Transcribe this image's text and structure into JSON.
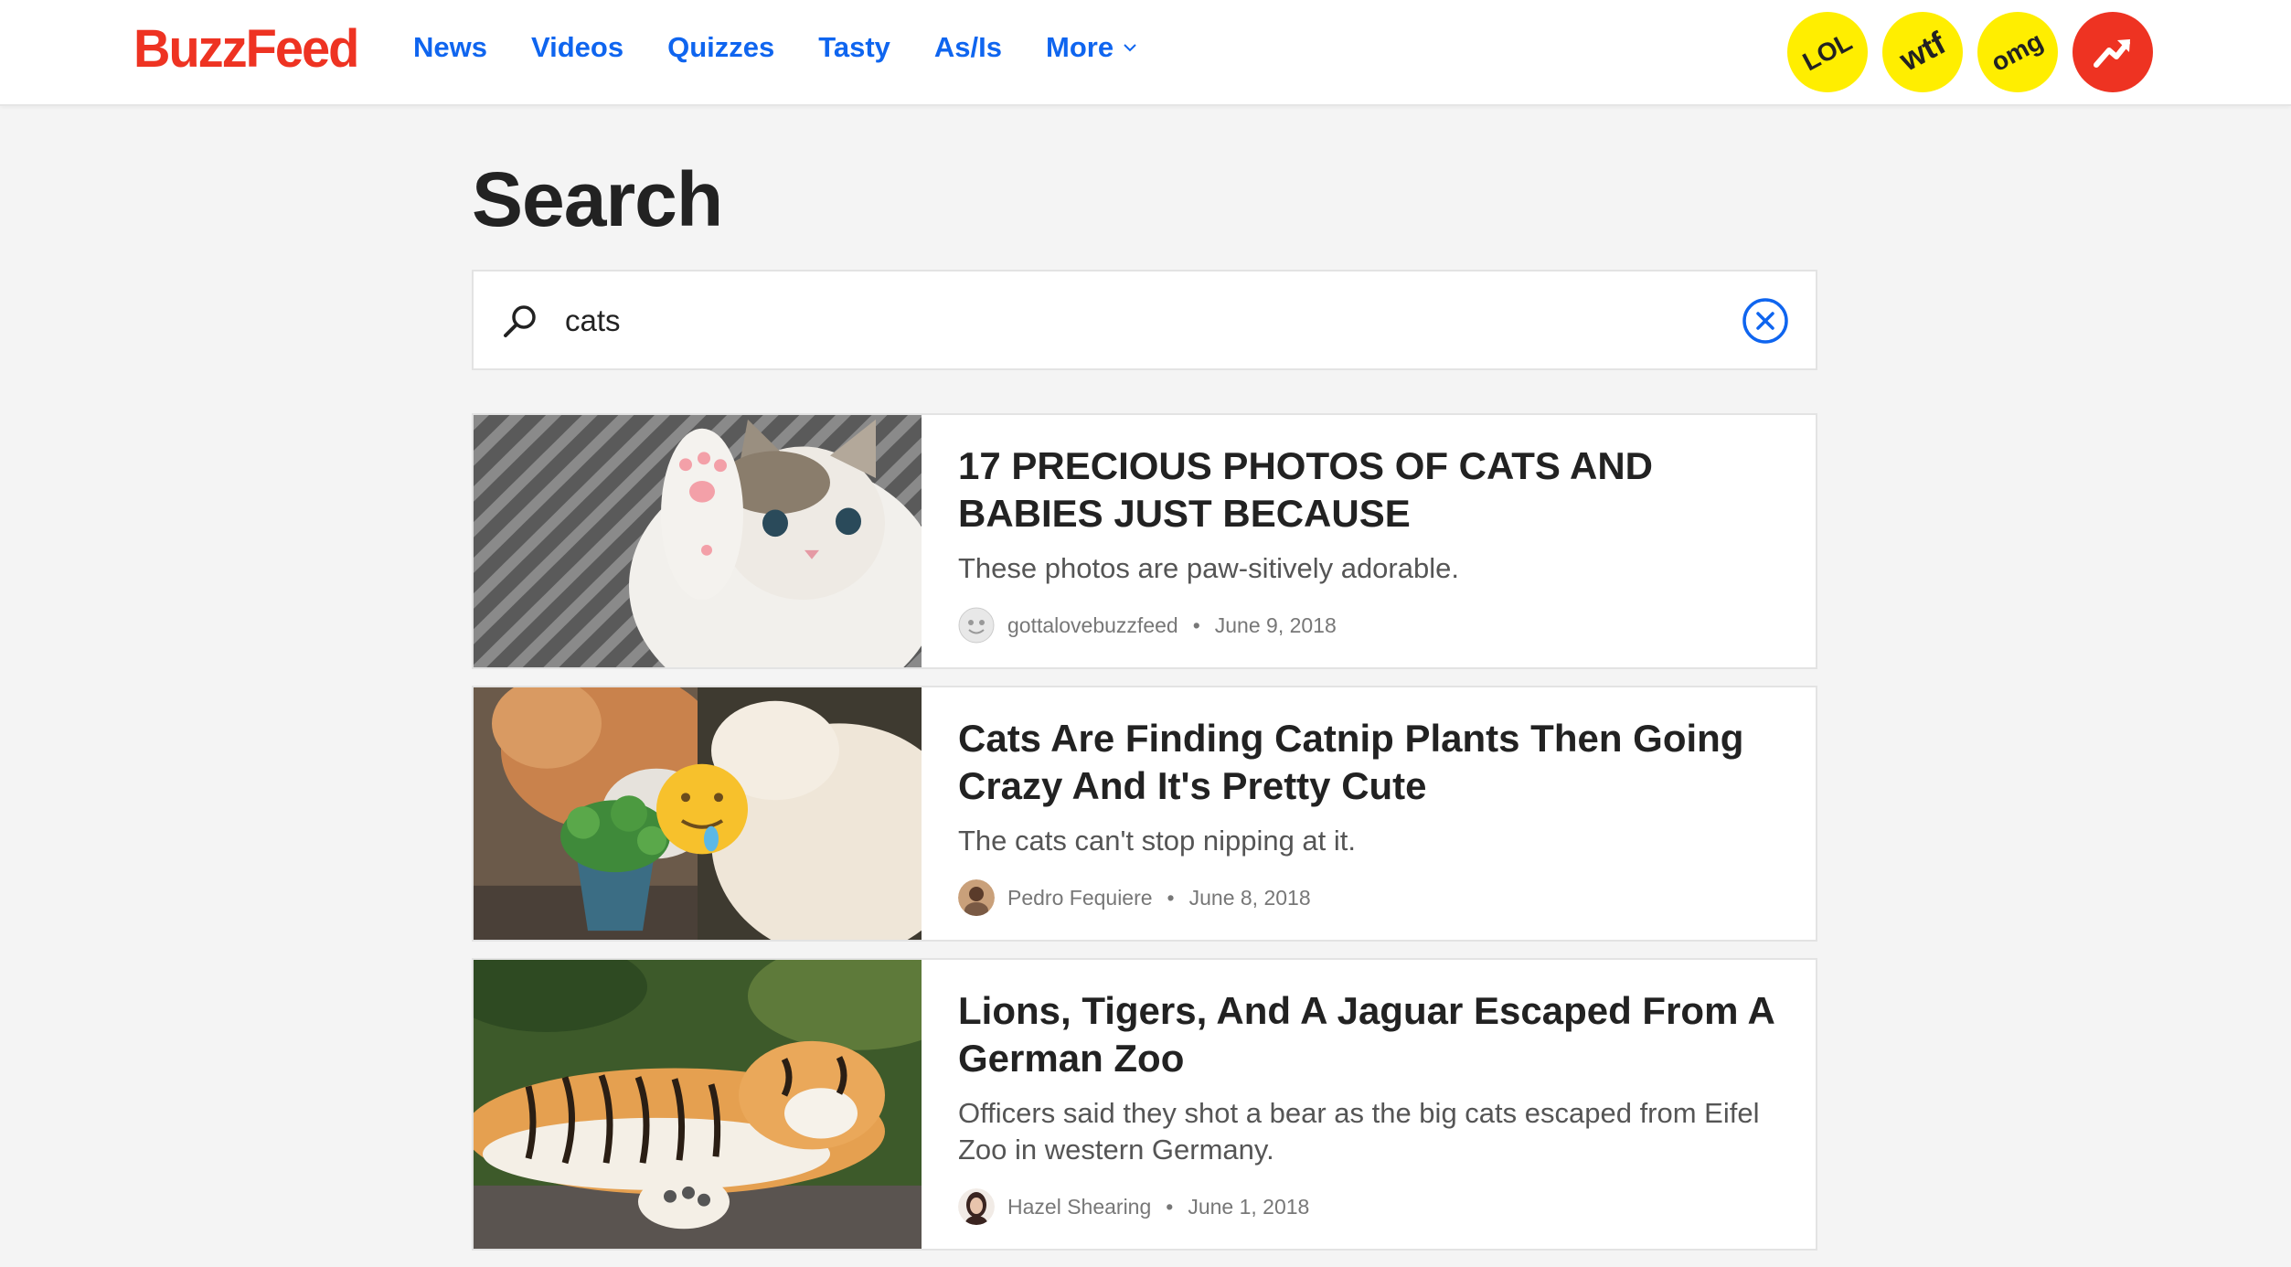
{
  "brand": {
    "logo_text": "BuzzFeed",
    "color": "#ee3322"
  },
  "nav": {
    "items": [
      {
        "label": "News"
      },
      {
        "label": "Videos"
      },
      {
        "label": "Quizzes"
      },
      {
        "label": "Tasty"
      },
      {
        "label": "As/Is"
      },
      {
        "label": "More"
      }
    ],
    "link_color": "#0f65ef"
  },
  "badges": [
    {
      "label": "LOL"
    },
    {
      "label": "wtf"
    },
    {
      "label": "omg"
    },
    {
      "icon": "trending-arrow-icon"
    }
  ],
  "page": {
    "title": "Search"
  },
  "search": {
    "value": "cats",
    "icon": "search-icon",
    "clear_icon": "clear-circle-icon"
  },
  "results": [
    {
      "title": "17 PRECIOUS PHOTOS OF CATS AND BABIES JUST BECAUSE",
      "description": "These photos are paw-sitively adorable.",
      "author": "gottalovebuzzfeed",
      "date": "June 9, 2018",
      "image": "kitten-photo"
    },
    {
      "title": "Cats Are Finding Catnip Plants Then Going Crazy And It's Pretty Cute",
      "description": "The cats can't stop nipping at it.",
      "author": "Pedro Fequiere",
      "date": "June 8, 2018",
      "image": "catnip-cats-photo"
    },
    {
      "title": "Lions, Tigers, And A Jaguar Escaped From A German Zoo",
      "description": "Officers said they shot a bear as the big cats escaped from Eifel Zoo in western Germany.",
      "author": "Hazel Shearing",
      "date": "June 1, 2018",
      "image": "tiger-photo"
    }
  ],
  "separator": "•"
}
